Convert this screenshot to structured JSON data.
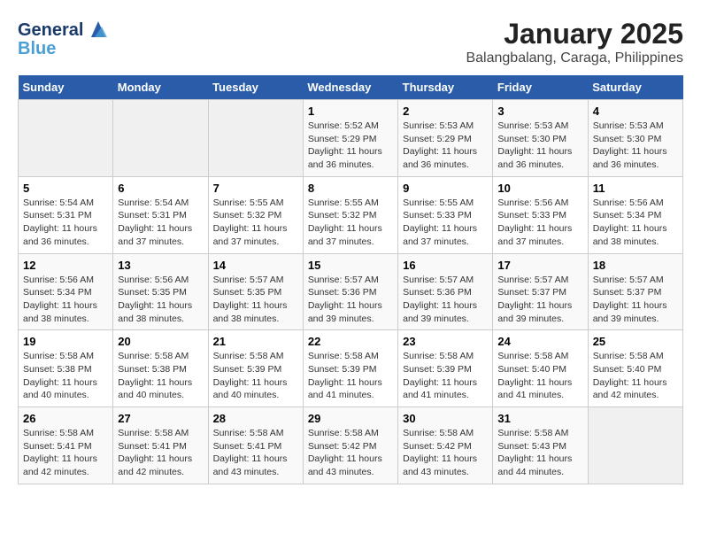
{
  "logo": {
    "line1": "General",
    "line2": "Blue"
  },
  "title": "January 2025",
  "subtitle": "Balangbalang, Caraga, Philippines",
  "days_of_week": [
    "Sunday",
    "Monday",
    "Tuesday",
    "Wednesday",
    "Thursday",
    "Friday",
    "Saturday"
  ],
  "weeks": [
    [
      {
        "day": "",
        "sunrise": "",
        "sunset": "",
        "daylight": "",
        "empty": true
      },
      {
        "day": "",
        "sunrise": "",
        "sunset": "",
        "daylight": "",
        "empty": true
      },
      {
        "day": "",
        "sunrise": "",
        "sunset": "",
        "daylight": "",
        "empty": true
      },
      {
        "day": "1",
        "sunrise": "Sunrise: 5:52 AM",
        "sunset": "Sunset: 5:29 PM",
        "daylight": "Daylight: 11 hours and 36 minutes."
      },
      {
        "day": "2",
        "sunrise": "Sunrise: 5:53 AM",
        "sunset": "Sunset: 5:29 PM",
        "daylight": "Daylight: 11 hours and 36 minutes."
      },
      {
        "day": "3",
        "sunrise": "Sunrise: 5:53 AM",
        "sunset": "Sunset: 5:30 PM",
        "daylight": "Daylight: 11 hours and 36 minutes."
      },
      {
        "day": "4",
        "sunrise": "Sunrise: 5:53 AM",
        "sunset": "Sunset: 5:30 PM",
        "daylight": "Daylight: 11 hours and 36 minutes."
      }
    ],
    [
      {
        "day": "5",
        "sunrise": "Sunrise: 5:54 AM",
        "sunset": "Sunset: 5:31 PM",
        "daylight": "Daylight: 11 hours and 36 minutes."
      },
      {
        "day": "6",
        "sunrise": "Sunrise: 5:54 AM",
        "sunset": "Sunset: 5:31 PM",
        "daylight": "Daylight: 11 hours and 37 minutes."
      },
      {
        "day": "7",
        "sunrise": "Sunrise: 5:55 AM",
        "sunset": "Sunset: 5:32 PM",
        "daylight": "Daylight: 11 hours and 37 minutes."
      },
      {
        "day": "8",
        "sunrise": "Sunrise: 5:55 AM",
        "sunset": "Sunset: 5:32 PM",
        "daylight": "Daylight: 11 hours and 37 minutes."
      },
      {
        "day": "9",
        "sunrise": "Sunrise: 5:55 AM",
        "sunset": "Sunset: 5:33 PM",
        "daylight": "Daylight: 11 hours and 37 minutes."
      },
      {
        "day": "10",
        "sunrise": "Sunrise: 5:56 AM",
        "sunset": "Sunset: 5:33 PM",
        "daylight": "Daylight: 11 hours and 37 minutes."
      },
      {
        "day": "11",
        "sunrise": "Sunrise: 5:56 AM",
        "sunset": "Sunset: 5:34 PM",
        "daylight": "Daylight: 11 hours and 38 minutes."
      }
    ],
    [
      {
        "day": "12",
        "sunrise": "Sunrise: 5:56 AM",
        "sunset": "Sunset: 5:34 PM",
        "daylight": "Daylight: 11 hours and 38 minutes."
      },
      {
        "day": "13",
        "sunrise": "Sunrise: 5:56 AM",
        "sunset": "Sunset: 5:35 PM",
        "daylight": "Daylight: 11 hours and 38 minutes."
      },
      {
        "day": "14",
        "sunrise": "Sunrise: 5:57 AM",
        "sunset": "Sunset: 5:35 PM",
        "daylight": "Daylight: 11 hours and 38 minutes."
      },
      {
        "day": "15",
        "sunrise": "Sunrise: 5:57 AM",
        "sunset": "Sunset: 5:36 PM",
        "daylight": "Daylight: 11 hours and 39 minutes."
      },
      {
        "day": "16",
        "sunrise": "Sunrise: 5:57 AM",
        "sunset": "Sunset: 5:36 PM",
        "daylight": "Daylight: 11 hours and 39 minutes."
      },
      {
        "day": "17",
        "sunrise": "Sunrise: 5:57 AM",
        "sunset": "Sunset: 5:37 PM",
        "daylight": "Daylight: 11 hours and 39 minutes."
      },
      {
        "day": "18",
        "sunrise": "Sunrise: 5:57 AM",
        "sunset": "Sunset: 5:37 PM",
        "daylight": "Daylight: 11 hours and 39 minutes."
      }
    ],
    [
      {
        "day": "19",
        "sunrise": "Sunrise: 5:58 AM",
        "sunset": "Sunset: 5:38 PM",
        "daylight": "Daylight: 11 hours and 40 minutes."
      },
      {
        "day": "20",
        "sunrise": "Sunrise: 5:58 AM",
        "sunset": "Sunset: 5:38 PM",
        "daylight": "Daylight: 11 hours and 40 minutes."
      },
      {
        "day": "21",
        "sunrise": "Sunrise: 5:58 AM",
        "sunset": "Sunset: 5:39 PM",
        "daylight": "Daylight: 11 hours and 40 minutes."
      },
      {
        "day": "22",
        "sunrise": "Sunrise: 5:58 AM",
        "sunset": "Sunset: 5:39 PM",
        "daylight": "Daylight: 11 hours and 41 minutes."
      },
      {
        "day": "23",
        "sunrise": "Sunrise: 5:58 AM",
        "sunset": "Sunset: 5:39 PM",
        "daylight": "Daylight: 11 hours and 41 minutes."
      },
      {
        "day": "24",
        "sunrise": "Sunrise: 5:58 AM",
        "sunset": "Sunset: 5:40 PM",
        "daylight": "Daylight: 11 hours and 41 minutes."
      },
      {
        "day": "25",
        "sunrise": "Sunrise: 5:58 AM",
        "sunset": "Sunset: 5:40 PM",
        "daylight": "Daylight: 11 hours and 42 minutes."
      }
    ],
    [
      {
        "day": "26",
        "sunrise": "Sunrise: 5:58 AM",
        "sunset": "Sunset: 5:41 PM",
        "daylight": "Daylight: 11 hours and 42 minutes."
      },
      {
        "day": "27",
        "sunrise": "Sunrise: 5:58 AM",
        "sunset": "Sunset: 5:41 PM",
        "daylight": "Daylight: 11 hours and 42 minutes."
      },
      {
        "day": "28",
        "sunrise": "Sunrise: 5:58 AM",
        "sunset": "Sunset: 5:41 PM",
        "daylight": "Daylight: 11 hours and 43 minutes."
      },
      {
        "day": "29",
        "sunrise": "Sunrise: 5:58 AM",
        "sunset": "Sunset: 5:42 PM",
        "daylight": "Daylight: 11 hours and 43 minutes."
      },
      {
        "day": "30",
        "sunrise": "Sunrise: 5:58 AM",
        "sunset": "Sunset: 5:42 PM",
        "daylight": "Daylight: 11 hours and 43 minutes."
      },
      {
        "day": "31",
        "sunrise": "Sunrise: 5:58 AM",
        "sunset": "Sunset: 5:43 PM",
        "daylight": "Daylight: 11 hours and 44 minutes."
      },
      {
        "day": "",
        "sunrise": "",
        "sunset": "",
        "daylight": "",
        "empty": true
      }
    ]
  ]
}
